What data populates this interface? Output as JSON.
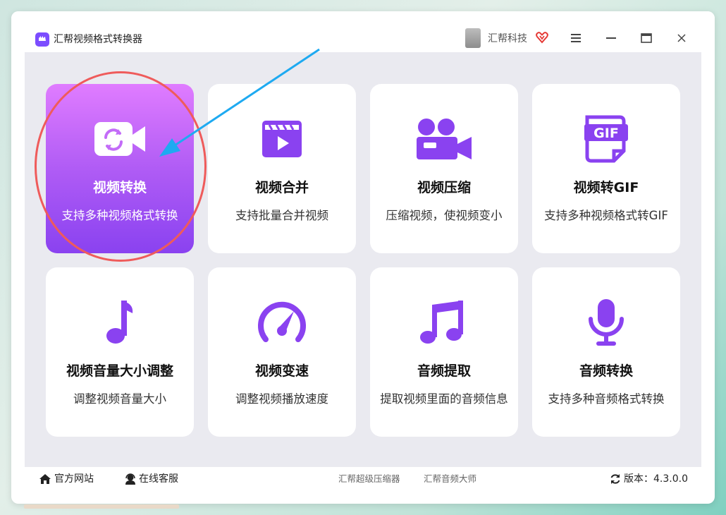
{
  "app": {
    "title": "汇帮视频格式转换器",
    "user_name": "汇帮科技",
    "icons": [
      "app-logo-icon",
      "vip-heart-icon",
      "menu-icon",
      "minimize-icon",
      "maximize-icon",
      "close-icon"
    ]
  },
  "cards": [
    {
      "title": "视频转换",
      "desc": "支持多种视频格式转换",
      "icon": "video-convert-icon",
      "active": true
    },
    {
      "title": "视频合并",
      "desc": "支持批量合并视频",
      "icon": "clapperboard-icon"
    },
    {
      "title": "视频压缩",
      "desc": "压缩视频，使视频变小",
      "icon": "video-camera-icon"
    },
    {
      "title": "视频转GIF",
      "desc": "支持多种视频格式转GIF",
      "icon": "gif-file-icon",
      "icon_text": "GIF"
    },
    {
      "title": "视频音量大小调整",
      "desc": "调整视频音量大小",
      "icon": "music-note-icon"
    },
    {
      "title": "视频变速",
      "desc": "调整视频播放速度",
      "icon": "speedometer-icon"
    },
    {
      "title": "音频提取",
      "desc": "提取视频里面的音频信息",
      "icon": "music-notes-icon"
    },
    {
      "title": "音频转换",
      "desc": "支持多种音频格式转换",
      "icon": "microphone-icon"
    }
  ],
  "footer": {
    "website": "官方网站",
    "support": "在线客服",
    "link1": "汇帮超级压缩器",
    "link2": "汇帮音频大师",
    "version": "版本：4.3.0.0"
  },
  "colors": {
    "accent": "#8a42f0",
    "card_gradient_top": "#e07cff",
    "annotation_circle": "#ef5b5b",
    "annotation_arrow": "#1eaaf1"
  }
}
